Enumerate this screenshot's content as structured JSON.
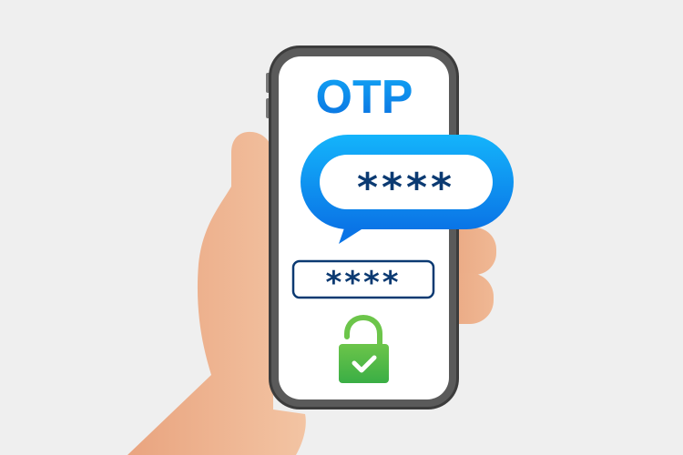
{
  "illustration": {
    "title": "OTP",
    "message_code": "****",
    "input_code": "****",
    "lock_state": "unlocked-verified"
  },
  "icons": {
    "lock": "unlocked-padlock-icon",
    "check": "check-icon"
  },
  "colors": {
    "background": "#efefef",
    "brand_blue": "#0a7de8",
    "bubble_blue_top": "#14b4fb",
    "bubble_blue_bottom": "#0a74e6",
    "navy": "#0b3a72",
    "green": "#46b848",
    "skin": "#eab08c"
  }
}
